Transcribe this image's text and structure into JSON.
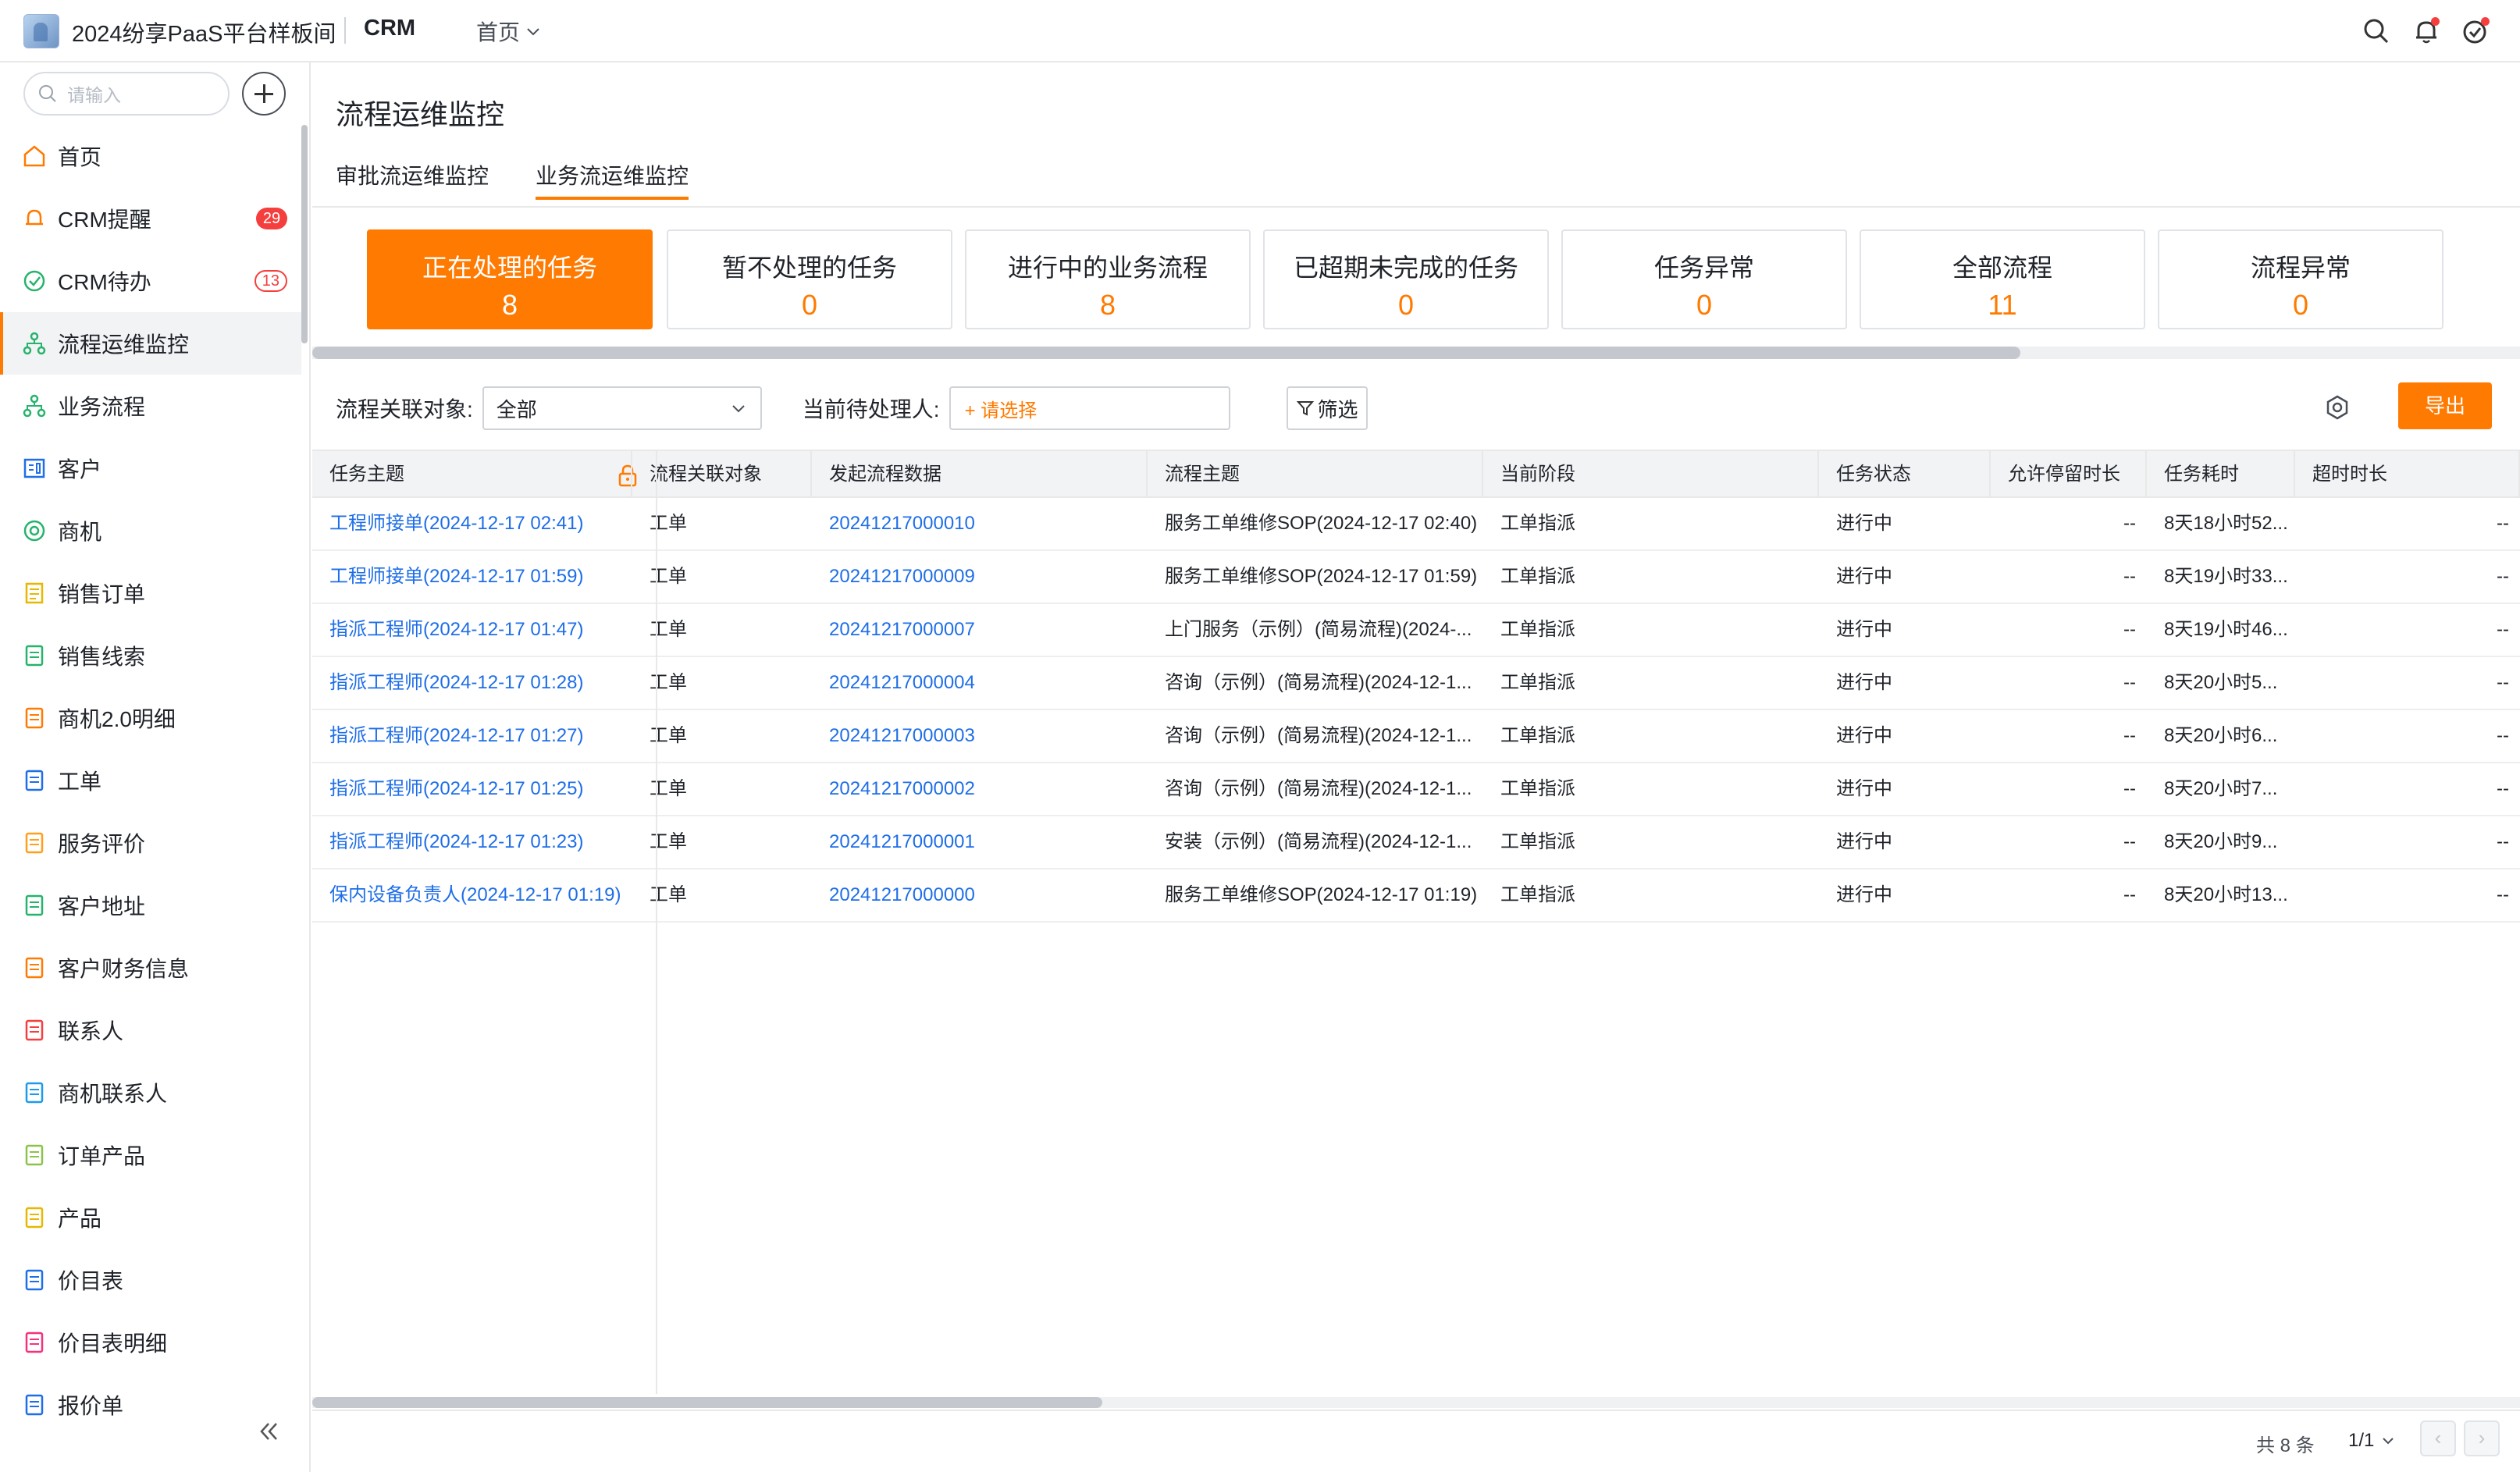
{
  "header": {
    "app_title": "2024纷享PaaS平台样板间",
    "module": "CRM",
    "nav_home": "首页",
    "icons": [
      "search-icon",
      "bell-icon",
      "task-check-icon"
    ]
  },
  "sidebar": {
    "search_placeholder": "请输入",
    "items": [
      {
        "label": "首页",
        "icon": "home-icon",
        "color": "#ff7a00"
      },
      {
        "label": "CRM提醒",
        "icon": "bell-icon",
        "color": "#ff7a00",
        "count": "29"
      },
      {
        "label": "CRM待办",
        "icon": "check-circle-icon",
        "color": "#26b36b",
        "count": "13"
      },
      {
        "label": "流程运维监控",
        "icon": "flow-icon",
        "color": "#26b36b",
        "active": true
      },
      {
        "label": "业务流程",
        "icon": "flow-icon",
        "color": "#26b36b"
      },
      {
        "label": "客户",
        "icon": "customer-icon",
        "color": "#1e6ee8"
      },
      {
        "label": "商机",
        "icon": "target-icon",
        "color": "#26b36b"
      },
      {
        "label": "销售订单",
        "icon": "order-icon",
        "color": "#e6b800"
      },
      {
        "label": "销售线索",
        "icon": "lead-icon",
        "color": "#26b36b"
      },
      {
        "label": "商机2.0明细",
        "icon": "doc-detail-icon",
        "color": "#ff7a00"
      },
      {
        "label": "工单",
        "icon": "ticket-icon",
        "color": "#1e6ee8"
      },
      {
        "label": "服务评价",
        "icon": "rating-icon",
        "color": "#ff9f1a"
      },
      {
        "label": "客户地址",
        "icon": "address-icon",
        "color": "#26b36b"
      },
      {
        "label": "客户财务信息",
        "icon": "finance-icon",
        "color": "#ff7a00"
      },
      {
        "label": "联系人",
        "icon": "contact-icon",
        "color": "#f53f3f"
      },
      {
        "label": "商机联系人",
        "icon": "contacts-icon",
        "color": "#1e9be8"
      },
      {
        "label": "订单产品",
        "icon": "order-product-icon",
        "color": "#8bc34a"
      },
      {
        "label": "产品",
        "icon": "product-box-icon",
        "color": "#e6b800"
      },
      {
        "label": "价目表",
        "icon": "pricelist-icon",
        "color": "#1e6ee8"
      },
      {
        "label": "价目表明细",
        "icon": "pricelist-detail-icon",
        "color": "#f5317f"
      },
      {
        "label": "报价单",
        "icon": "quote-icon",
        "color": "#1e6ee8"
      }
    ]
  },
  "page": {
    "title": "流程运维监控",
    "tabs": [
      {
        "label": "审批流运维监控",
        "active": false
      },
      {
        "label": "业务流运维监控",
        "active": true
      }
    ]
  },
  "cards": [
    {
      "label": "正在处理的任务",
      "value": "8",
      "active": true
    },
    {
      "label": "暂不处理的任务",
      "value": "0"
    },
    {
      "label": "进行中的业务流程",
      "value": "8"
    },
    {
      "label": "已超期未完成的任务",
      "value": "0"
    },
    {
      "label": "任务异常",
      "value": "0"
    },
    {
      "label": "全部流程",
      "value": "11"
    },
    {
      "label": "流程异常",
      "value": "0"
    }
  ],
  "filters": {
    "object_label": "流程关联对象:",
    "object_value": "全部",
    "handler_label": "当前待处理人:",
    "handler_placeholder": "+ 请选择",
    "filter_button": "筛选",
    "export_button": "导出"
  },
  "table": {
    "columns": [
      "任务主题",
      "流程关联对象",
      "发起流程数据",
      "流程主题",
      "当前阶段",
      "任务状态",
      "允许停留时长",
      "任务耗时",
      "超时时长"
    ],
    "rows": [
      [
        "工程师接单(2024-12-17 02:41)",
        "工单",
        "20241217000010",
        "服务工单维修SOP(2024-12-17 02:40)",
        "工单指派",
        "进行中",
        "--",
        "8天18小时52...",
        "--"
      ],
      [
        "工程师接单(2024-12-17 01:59)",
        "工单",
        "20241217000009",
        "服务工单维修SOP(2024-12-17 01:59)",
        "工单指派",
        "进行中",
        "--",
        "8天19小时33...",
        "--"
      ],
      [
        "指派工程师(2024-12-17 01:47)",
        "工单",
        "20241217000007",
        "上门服务（示例）(简易流程)(2024-...",
        "工单指派",
        "进行中",
        "--",
        "8天19小时46...",
        "--"
      ],
      [
        "指派工程师(2024-12-17 01:28)",
        "工单",
        "20241217000004",
        "咨询（示例）(简易流程)(2024-12-1...",
        "工单指派",
        "进行中",
        "--",
        "8天20小时5...",
        "--"
      ],
      [
        "指派工程师(2024-12-17 01:27)",
        "工单",
        "20241217000003",
        "咨询（示例）(简易流程)(2024-12-1...",
        "工单指派",
        "进行中",
        "--",
        "8天20小时6...",
        "--"
      ],
      [
        "指派工程师(2024-12-17 01:25)",
        "工单",
        "20241217000002",
        "咨询（示例）(简易流程)(2024-12-1...",
        "工单指派",
        "进行中",
        "--",
        "8天20小时7...",
        "--"
      ],
      [
        "指派工程师(2024-12-17 01:23)",
        "工单",
        "20241217000001",
        "安装（示例）(简易流程)(2024-12-1...",
        "工单指派",
        "进行中",
        "--",
        "8天20小时9...",
        "--"
      ],
      [
        "保内设备负责人(2024-12-17 01:19)",
        "工单",
        "20241217000000",
        "服务工单维修SOP(2024-12-17 01:19)",
        "工单指派",
        "进行中",
        "--",
        "8天20小时13...",
        "--"
      ]
    ]
  },
  "pager": {
    "total": "共 8 条",
    "page": "1/1"
  },
  "colors": {
    "accent": "#ff7a00",
    "link": "#1e6ee8",
    "badge": "#f53f3f"
  }
}
